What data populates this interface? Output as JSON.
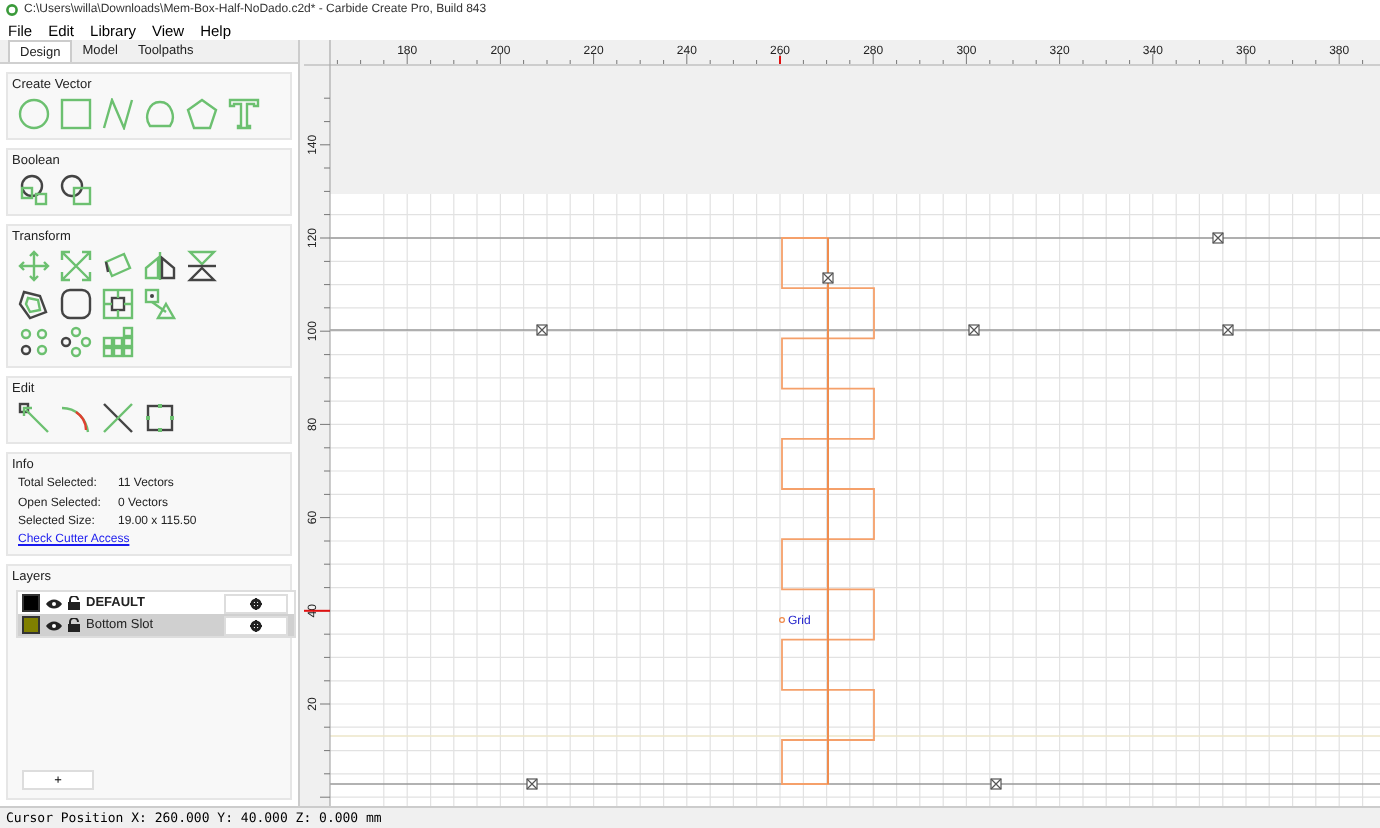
{
  "window": {
    "title": "C:\\Users\\willa\\Downloads\\Mem-Box-Half-NoDado.c2d* - Carbide Create Pro, Build 843"
  },
  "menu": [
    "File",
    "Edit",
    "Library",
    "View",
    "Help"
  ],
  "tabs": [
    {
      "label": "Design",
      "selected": true
    },
    {
      "label": "Model",
      "selected": false
    },
    {
      "label": "Toolpaths",
      "selected": false
    }
  ],
  "groups": [
    {
      "kind": "tools",
      "title": "Create Vector"
    },
    {
      "kind": "tools",
      "title": "Boolean"
    },
    {
      "kind": "tools",
      "title": "Transform"
    },
    {
      "kind": "tools",
      "title": "Edit"
    },
    {
      "kind": "info",
      "title": "Info",
      "rows": [
        {
          "label": "Total Selected:",
          "value": "11 Vectors"
        },
        {
          "label": "Open Selected:",
          "value": "0 Vectors"
        },
        {
          "label": "Selected Size:",
          "value": "19.00 x 115.50"
        }
      ],
      "link": "Check Cutter Access"
    },
    {
      "kind": "layers",
      "title": "Layers",
      "layers": [
        {
          "name": "DEFAULT",
          "color": "#000000",
          "selected": false
        },
        {
          "name": "Bottom Slot",
          "color": "#808000",
          "selected": true
        }
      ],
      "add_button": "+"
    }
  ],
  "canvas": {
    "x_ruler": [
      "180",
      "200",
      "220",
      "240",
      "260",
      "280",
      "300",
      "320",
      "340",
      "360",
      "380"
    ],
    "y_ruler": [
      "20",
      "40",
      "60",
      "80",
      "100",
      "120",
      "140"
    ],
    "origin_label": "Grid"
  },
  "status_bar": "Cursor Position X: 260.000 Y: 40.000 Z: 0.000 mm"
}
